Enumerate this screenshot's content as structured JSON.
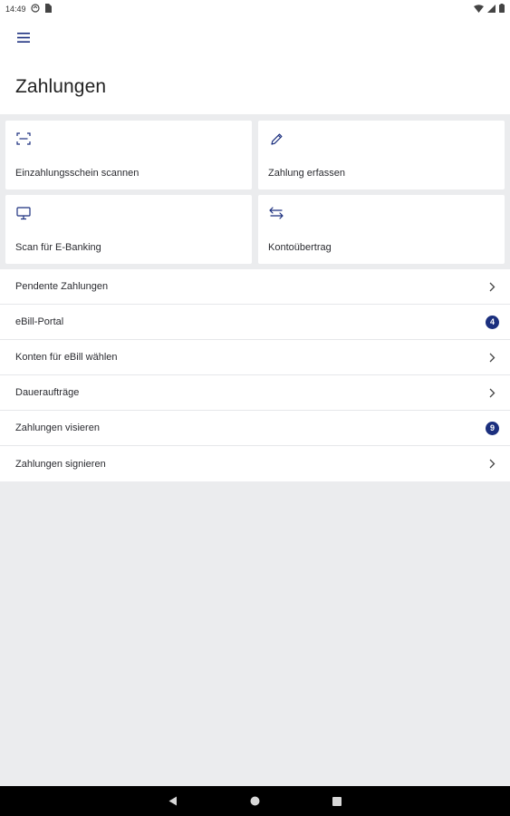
{
  "status_bar": {
    "time": "14:49",
    "left_icons": [
      "sync-icon",
      "sim-card-icon"
    ],
    "right_icons": [
      "wifi-icon",
      "cell-signal-icon",
      "battery-icon"
    ]
  },
  "header": {
    "menu_icon": "hamburger-menu-icon",
    "title": "Zahlungen"
  },
  "tiles": [
    {
      "label": "Einzahlungsschein scannen",
      "icon": "scan-icon"
    },
    {
      "label": "Zahlung erfassen",
      "icon": "pencil-icon"
    },
    {
      "label": "Scan für E-Banking",
      "icon": "monitor-icon"
    },
    {
      "label": "Kontoübertrag",
      "icon": "transfer-arrows-icon"
    }
  ],
  "list": [
    {
      "label": "Pendente Zahlungen",
      "badge": null
    },
    {
      "label": "eBill-Portal",
      "badge": "4"
    },
    {
      "label": "Konten für eBill wählen",
      "badge": null
    },
    {
      "label": "Daueraufträge",
      "badge": null
    },
    {
      "label": "Zahlungen visieren",
      "badge": "9"
    },
    {
      "label": "Zahlungen signieren",
      "badge": null
    }
  ],
  "colors": {
    "accent": "#1b2f7e",
    "background": "#ebecee",
    "card": "#ffffff"
  },
  "nav_bar": [
    "back-icon",
    "home-icon",
    "recents-icon"
  ]
}
